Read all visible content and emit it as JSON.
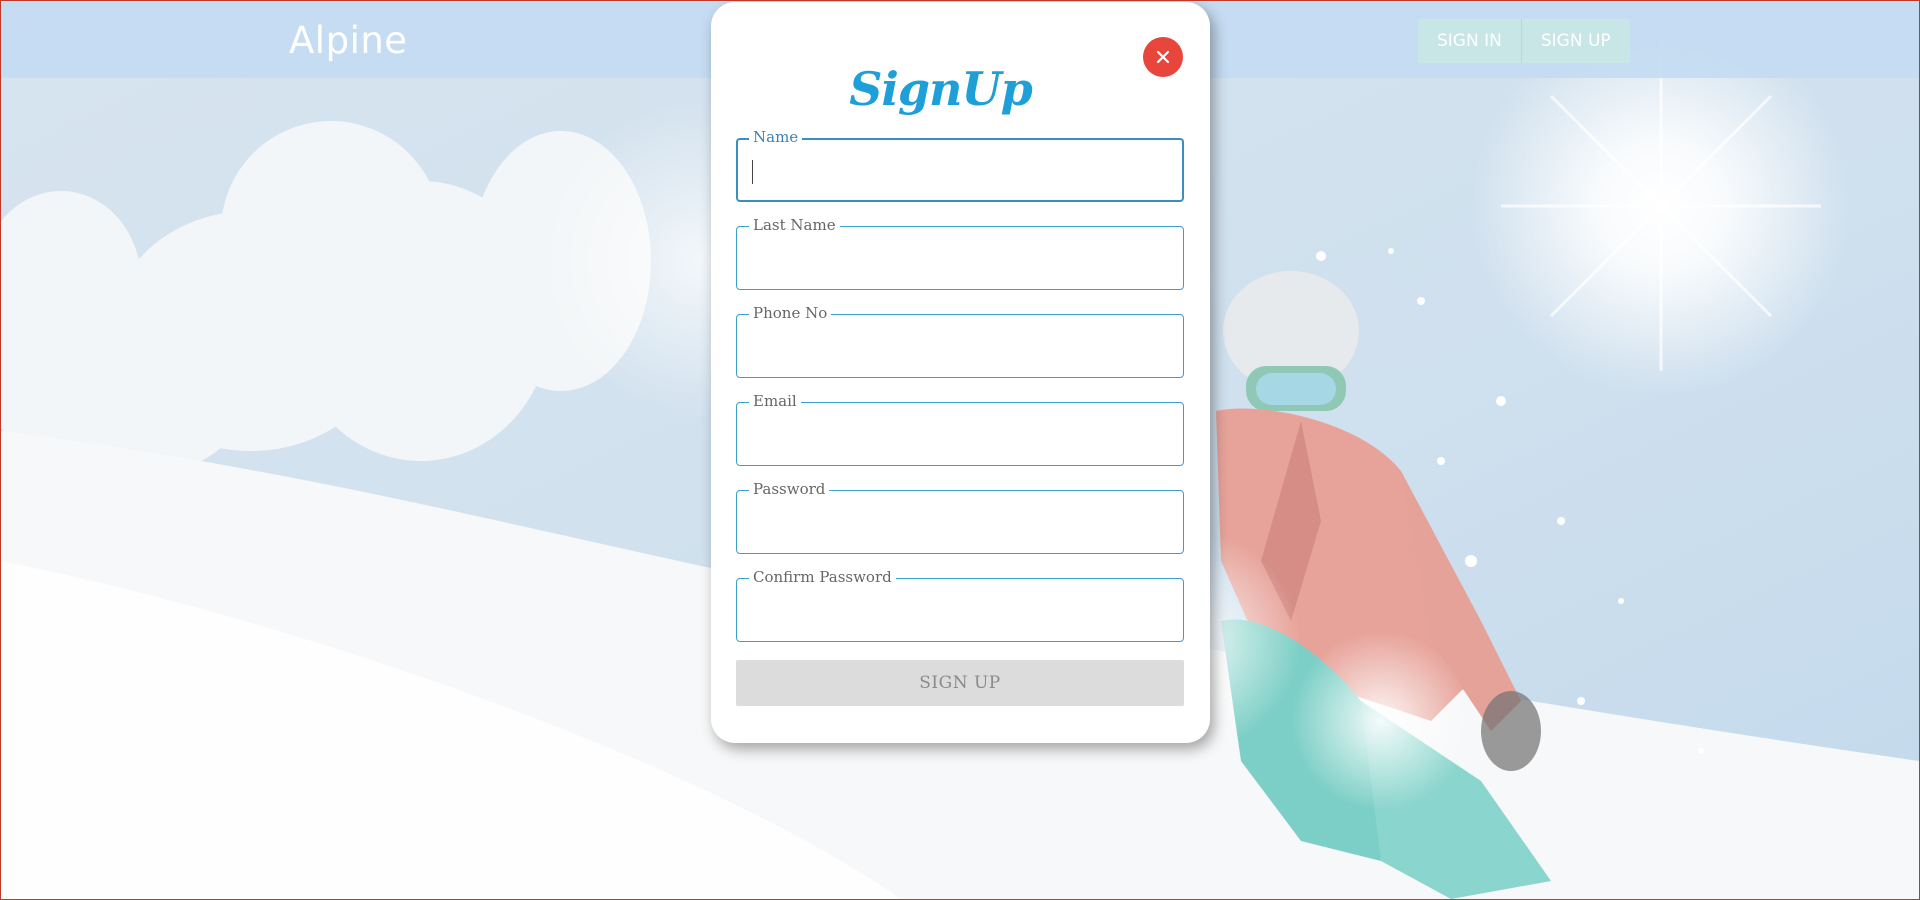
{
  "header": {
    "brand": "Alpine",
    "nav": {
      "sign_in": "SIGN IN",
      "sign_up": "SIGN UP"
    }
  },
  "modal": {
    "title": "SignUp",
    "close_icon": "close-icon",
    "fields": [
      {
        "label": "Name",
        "value": "",
        "focused": true
      },
      {
        "label": "Last Name",
        "value": ""
      },
      {
        "label": "Phone No",
        "value": ""
      },
      {
        "label": "Email",
        "value": ""
      },
      {
        "label": "Password",
        "value": ""
      },
      {
        "label": "Confirm Password",
        "value": ""
      }
    ],
    "submit_label": "SIGN UP"
  },
  "colors": {
    "accent": "#1e9fd8",
    "close": "#e8453c",
    "header": "#c4dbf2"
  }
}
